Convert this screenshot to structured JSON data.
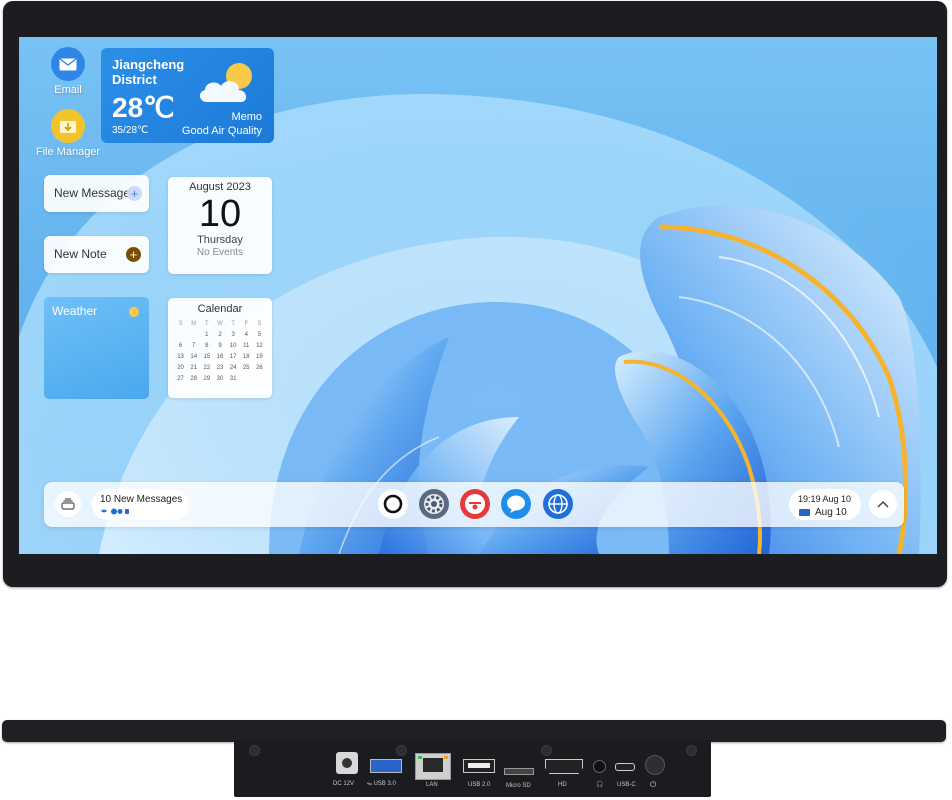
{
  "desktop": {
    "icons": [
      {
        "label": "Email",
        "icon": "mail-icon",
        "color": "#2f86e6"
      },
      {
        "label": "File Manager",
        "icon": "folder-icon",
        "color": "#f2c42c"
      }
    ]
  },
  "weather_widget": {
    "location": "Jiangcheng District",
    "temperature": "28℃",
    "range": "35/28℃",
    "memo": "Memo",
    "air_quality": "Good Air Quality",
    "icon": "sun-cloud-icon"
  },
  "widgets": {
    "new_message": {
      "label": "New Message",
      "icon": "plus-icon",
      "accent": "#5b7fe0"
    },
    "new_note": {
      "label": "New Note",
      "icon": "plus-icon",
      "accent": "#8a5a00"
    },
    "date": {
      "month": "August 2023",
      "day": "10",
      "weekday": "Thursday",
      "events": "No Events"
    },
    "weather": {
      "label": "Weather",
      "icon": "sun-icon"
    },
    "calendar": {
      "title": "Calendar",
      "weekdays": [
        "S",
        "M",
        "T",
        "W",
        "T",
        "F",
        "S"
      ],
      "days": [
        "",
        "",
        "1",
        "2",
        "3",
        "4",
        "5",
        "6",
        "7",
        "8",
        "9",
        "10",
        "11",
        "12",
        "13",
        "14",
        "15",
        "16",
        "17",
        "18",
        "19",
        "20",
        "21",
        "22",
        "23",
        "24",
        "25",
        "26",
        "27",
        "28",
        "29",
        "30",
        "31",
        "",
        "",
        "",
        ""
      ]
    }
  },
  "taskbar": {
    "menu_icon": "stack-icon",
    "messages": "10 New Messages",
    "dock": [
      {
        "name": "circle-app-icon",
        "color": "#111111"
      },
      {
        "name": "settings-gear-icon",
        "color": "#4a5a70"
      },
      {
        "name": "music-app-icon",
        "color": "#e43a3a"
      },
      {
        "name": "chat-bubble-icon",
        "color": "#1f8ee8"
      },
      {
        "name": "browser-globe-icon",
        "color": "#1f6fd8"
      }
    ],
    "time": "19:19 Aug 10",
    "date": "Aug 10",
    "expand_icon": "chevron-up-icon"
  },
  "ports": {
    "dc": "DC 12V",
    "usb3": "USB 3.0",
    "lan": "LAN",
    "usb2": "USB 2.0",
    "microsd": "Micro SD",
    "hd": "HD",
    "usbc": "USB-C",
    "audio_icon": "headphone-icon",
    "power_icon": "power-icon",
    "usb_icon": "usb-icon"
  }
}
